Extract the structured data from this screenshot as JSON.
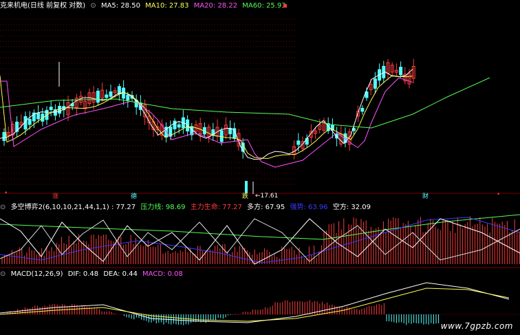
{
  "main_header": {
    "stock_name": "克来机电(日线 前复权 对数)",
    "ma5": "MA5: 28.50",
    "ma10": "MA10: 27.83",
    "ma20": "MA20: 28.22",
    "ma60": "MA60: 25.93"
  },
  "main_chart": {
    "low_label": "17.61",
    "event_markers": [
      "涨",
      "德",
      "跌",
      "财"
    ]
  },
  "indicator_header": {
    "name": "多空博弈2(6,10,10,21,44,1,1) : 77.27",
    "pressure": "压力线: 98.69",
    "main_life": "主力生命: 77.27",
    "long": "多方: 67.95",
    "short_line": "强势: 63.96",
    "short": "空方: 32.09"
  },
  "macd_header": {
    "name": "MACD(12,26,9)",
    "dif": "DIF: 0.48",
    "dea": "DEA: 0.44",
    "macd": "MACD: 0.08"
  },
  "watermark": "www.7gpzb.com",
  "colors": {
    "up": "#ff3b3b",
    "down": "#54ffff",
    "ma5": "#ffffff",
    "ma10": "#ffff54",
    "ma20": "#ff54ff",
    "ma60": "#54ff54",
    "grid": "#7a0000"
  }
}
